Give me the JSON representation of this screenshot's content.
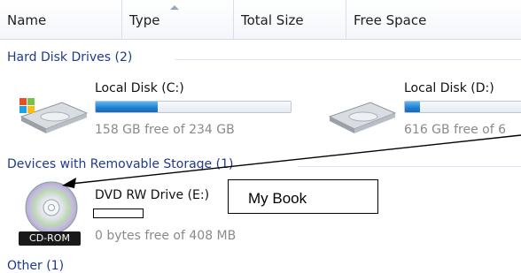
{
  "columns": {
    "name": "Name",
    "type": "Type",
    "total_size": "Total Size",
    "free_space": "Free Space"
  },
  "groups": {
    "hard_disks": "Hard Disk Drives (2)",
    "removable": "Devices with Removable Storage (1)",
    "other": "Other (1)"
  },
  "drives": [
    {
      "name": "Local Disk (C:)",
      "free": "158 GB free of 234 GB",
      "used_fraction": 0.32
    },
    {
      "name": "Local Disk (D:)",
      "free": "616 GB free of 6",
      "used_fraction": 0.12
    }
  ],
  "dvd": {
    "name": "DVD RW Drive (E:)",
    "free": "0 bytes free of 408 MB",
    "badge": "CD-ROM"
  },
  "annotation": {
    "label": "My Book"
  },
  "colors": {
    "accent": "#1f7fd0",
    "group_text": "#1e3a8a"
  }
}
